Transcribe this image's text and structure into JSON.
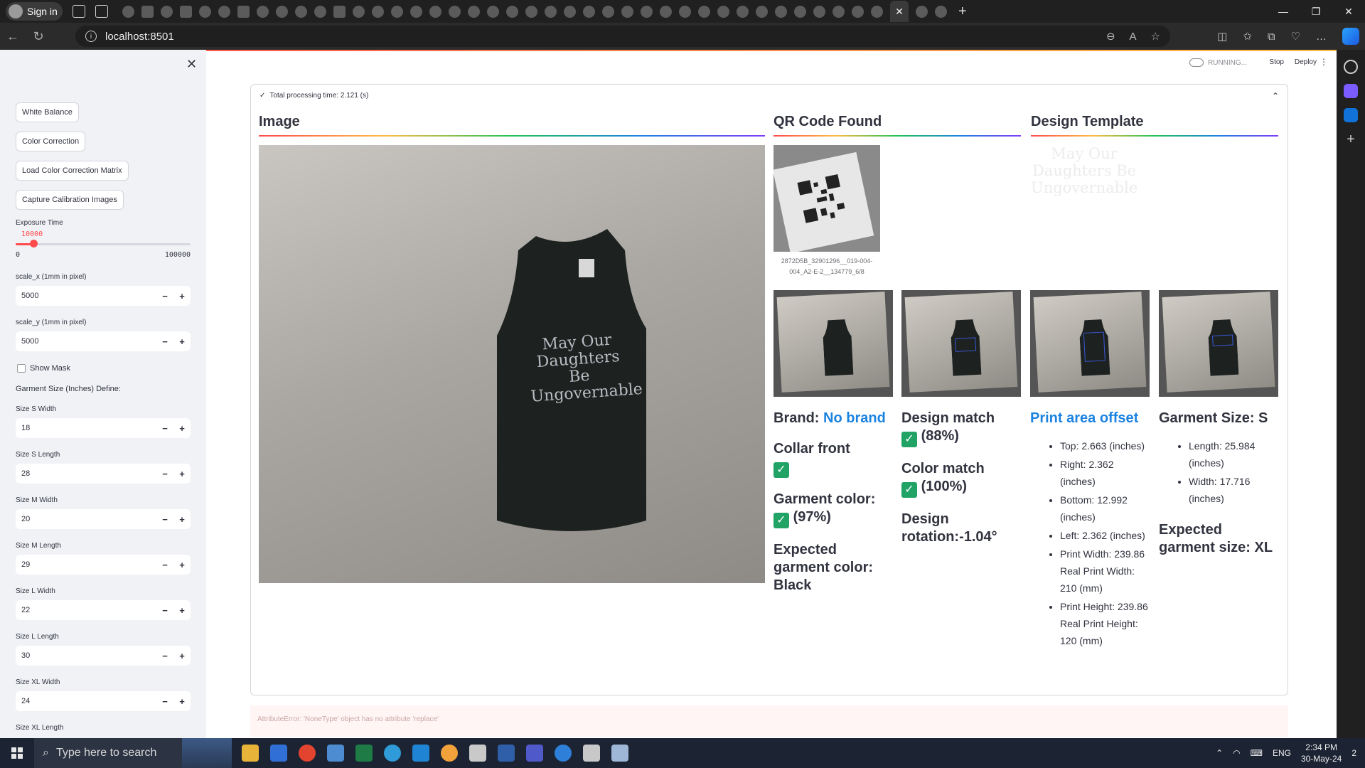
{
  "browser": {
    "signin_label": "Sign in",
    "url": "localhost:8501",
    "tab_close_glyph": "✕",
    "new_tab_glyph": "+",
    "window_controls": [
      "—",
      "❐",
      "✕"
    ]
  },
  "sidebar": {
    "close_glyph": "✕",
    "buttons": [
      "White Balance",
      "Color Correction",
      "Load Color Correction Matrix",
      "Capture Calibration Images"
    ],
    "exposure": {
      "label": "Exposure Time",
      "value": "10000",
      "min": "0",
      "max": "100000",
      "fraction": 0.1
    },
    "scale_x": {
      "label": "scale_x (1mm in pixel)",
      "value": "5000"
    },
    "scale_y": {
      "label": "scale_y (1mm in pixel)",
      "value": "5000"
    },
    "show_mask_label": "Show Mask",
    "garment_size_heading": "Garment Size (Inches) Define:",
    "sizes": [
      {
        "label": "Size S Width",
        "value": "18"
      },
      {
        "label": "Size S Length",
        "value": "28"
      },
      {
        "label": "Size M Width",
        "value": "20"
      },
      {
        "label": "Size M Length",
        "value": "29"
      },
      {
        "label": "Size L Width",
        "value": "22"
      },
      {
        "label": "Size L Length",
        "value": "30"
      },
      {
        "label": "Size XL Width",
        "value": "24"
      },
      {
        "label": "Size XL Length",
        "value": ""
      }
    ],
    "minus": "−",
    "plus": "+"
  },
  "header": {
    "running": "RUNNING...",
    "stop": "Stop",
    "deploy": "Deploy",
    "menu_glyph": "⋮"
  },
  "expander": {
    "title": "Total processing time: 2.121 (s)",
    "caret": "⌃"
  },
  "sections": {
    "image": "Image",
    "qr": "QR Code Found",
    "template": "Design Template"
  },
  "qr_caption": "2872D5B_32901296__019-004-004_A2-E-2__134779_6/8",
  "template_text": "May Our Daughters Be Ungovernable",
  "shirt_text": "May Our Daughters Be Ungovernable",
  "col1": {
    "brand_label": "Brand:",
    "brand_value": "No brand",
    "collar": "Collar front",
    "garment_color": "Garment color:",
    "garment_color_pct": "(97%)",
    "expected_color": "Expected garment color: Black"
  },
  "col2": {
    "design_match": "Design match",
    "design_match_pct": "(88%)",
    "color_match": "Color match",
    "color_match_pct": "(100%)",
    "rotation": "Design rotation:-1.04°"
  },
  "col3": {
    "heading": "Print area offset",
    "items": [
      "Top: 2.663 (inches)",
      "Right: 2.362 (inches)",
      "Bottom: 12.992 (inches)",
      "Left: 2.362 (inches)",
      "Print Width: 239.86 Real Print Width: 210 (mm)",
      "Print Height: 239.86 Real Print Height: 120 (mm)"
    ]
  },
  "col4": {
    "heading": "Garment Size: S",
    "items": [
      "Length: 25.984 (inches)",
      "Width: 17.716 (inches)"
    ],
    "expected": "Expected garment size: XL"
  },
  "error": "AttributeError: 'NoneType' object has no attribute 'replace'",
  "check_glyph": "✓",
  "taskbar": {
    "search_placeholder": "Type here to search",
    "lang": "ENG",
    "time": "2:34 PM",
    "date": "30-May-24",
    "notif_count": "2"
  },
  "colors": {
    "streamlit_red": "#ff4b4b",
    "link_blue": "#1c83e1",
    "check_green": "#21a366"
  }
}
